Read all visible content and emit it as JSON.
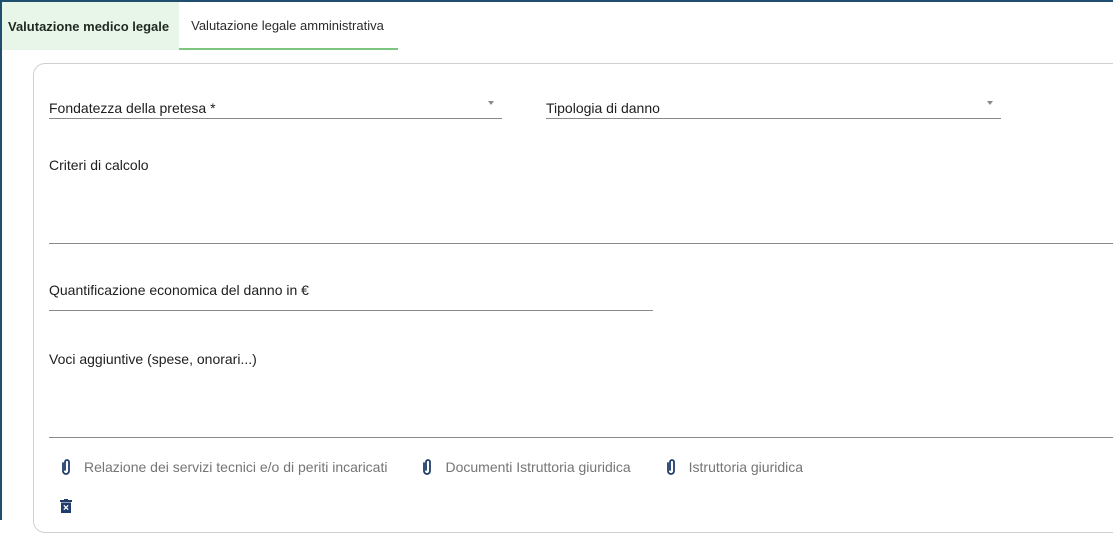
{
  "tabs": [
    {
      "label": "Valutazione medico legale"
    },
    {
      "label": "Valutazione legale amministrativa"
    }
  ],
  "form": {
    "fondatezza": {
      "label": "Fondatezza della pretesa *",
      "value": ""
    },
    "tipologia": {
      "label": "Tipologia di danno",
      "value": ""
    },
    "criteri": {
      "label": "Criteri di calcolo",
      "value": ""
    },
    "quantificazione": {
      "label": "Quantificazione economica del danno in €",
      "value": ""
    },
    "voci": {
      "label": "Voci aggiuntive (spese, onorari...)",
      "value": ""
    }
  },
  "attachments": [
    {
      "label": "Relazione dei servizi tecnici e/o di periti incaricati",
      "icon": "paperclip-icon"
    },
    {
      "label": "Documenti Istruttoria giuridica",
      "icon": "paperclip-icon"
    },
    {
      "label": "Istruttoria giuridica",
      "icon": "paperclip-icon"
    }
  ],
  "actions": {
    "delete_icon": "trash-icon"
  },
  "colors": {
    "accent": "#1f4e6e",
    "tab_active_bg": "#e8f5e9",
    "tab_underline": "#7cc77f",
    "icon": "#1f3d6b"
  }
}
